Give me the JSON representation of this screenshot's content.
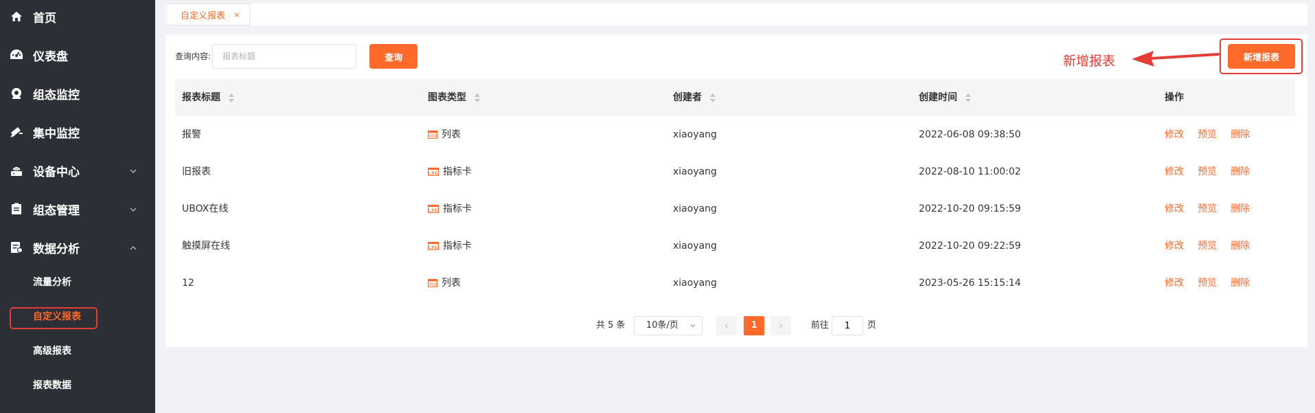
{
  "sidebar": {
    "items": [
      {
        "label": "首页",
        "icon": "home-icon"
      },
      {
        "label": "仪表盘",
        "icon": "dashboard-icon"
      },
      {
        "label": "组态监控",
        "icon": "monitor-icon"
      },
      {
        "label": "集中监控",
        "icon": "camera-icon"
      },
      {
        "label": "设备中心",
        "icon": "device-icon"
      },
      {
        "label": "组态管理",
        "icon": "clipboard-icon"
      },
      {
        "label": "数据分析",
        "icon": "analysis-icon"
      }
    ],
    "sub_items": [
      "流量分析",
      "自定义报表",
      "高级报表",
      "报表数据"
    ]
  },
  "tabs": [
    {
      "label": "自定义报表",
      "close": "×"
    }
  ],
  "search": {
    "label": "查询内容:",
    "placeholder": "报表标题",
    "button": "查询"
  },
  "add_button": "新增报表",
  "annotation": "新增报表",
  "table": {
    "columns": [
      "报表标题",
      "图表类型",
      "创建者",
      "创建时间",
      "操作"
    ],
    "rows": [
      {
        "title": "报警",
        "type": "列表",
        "creator": "xiaoyang",
        "time": "2022-06-08 09:38:50"
      },
      {
        "title": "旧报表",
        "type": "指标卡",
        "creator": "xiaoyang",
        "time": "2022-08-10 11:00:02"
      },
      {
        "title": "UBOX在线",
        "type": "指标卡",
        "creator": "xiaoyang",
        "time": "2022-10-20 09:15:59"
      },
      {
        "title": "触摸屏在线",
        "type": "指标卡",
        "creator": "xiaoyang",
        "time": "2022-10-20 09:22:59"
      },
      {
        "title": "12",
        "type": "列表",
        "creator": "xiaoyang",
        "time": "2023-05-26 15:15:14"
      }
    ],
    "actions": [
      "修改",
      "预览",
      "删除"
    ]
  },
  "pagination": {
    "total": "共 5 条",
    "page_size": "10条/页",
    "current": "1",
    "goto_label": "前往",
    "goto_value": "1",
    "page_label": "页"
  },
  "colors": {
    "accent": "#ff6a2b",
    "annotation": "#e43d35",
    "sidebar": "#2d2f36"
  }
}
